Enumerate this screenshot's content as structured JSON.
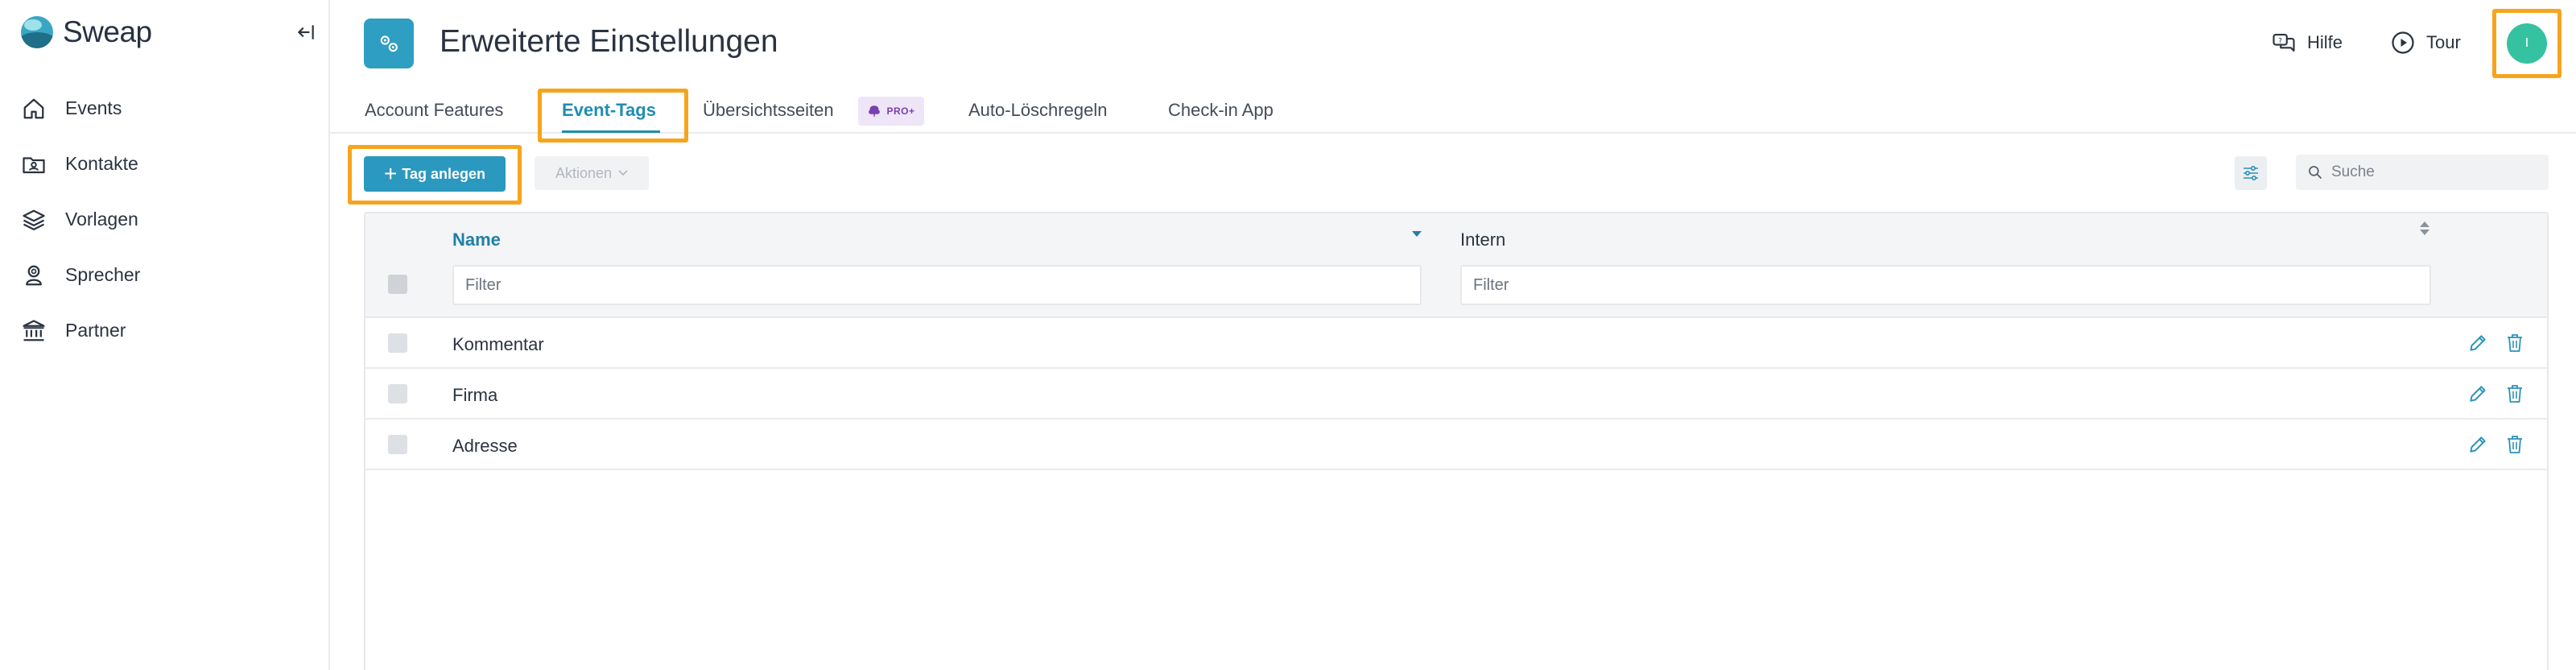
{
  "sidebar": {
    "brand": "Sweap",
    "items": [
      {
        "label": "Events",
        "icon": "home-icon"
      },
      {
        "label": "Kontakte",
        "icon": "contacts-icon"
      },
      {
        "label": "Vorlagen",
        "icon": "layers-icon"
      },
      {
        "label": "Sprecher",
        "icon": "speaker-icon"
      },
      {
        "label": "Partner",
        "icon": "bank-icon"
      }
    ]
  },
  "header": {
    "title": "Erweiterte Einstellungen",
    "help_label": "Hilfe",
    "tour_label": "Tour",
    "avatar_initial": "I"
  },
  "tabs": [
    {
      "label": "Account Features",
      "active": false
    },
    {
      "label": "Event-Tags",
      "active": true
    },
    {
      "label": "Übersichtsseiten",
      "active": false,
      "badge": "PRO+"
    },
    {
      "label": "Auto-Löschregeln",
      "active": false
    },
    {
      "label": "Check-in App",
      "active": false
    }
  ],
  "toolbar": {
    "add_label": "Tag anlegen",
    "actions_label": "Aktionen",
    "search_placeholder": "Suche"
  },
  "table": {
    "columns": [
      {
        "label": "Name",
        "sorted": "desc"
      },
      {
        "label": "Intern",
        "sorted": "none"
      }
    ],
    "filter_placeholder": "Filter",
    "rows": [
      {
        "name": "Kommentar",
        "intern": ""
      },
      {
        "name": "Firma",
        "intern": ""
      },
      {
        "name": "Adresse",
        "intern": ""
      }
    ]
  },
  "colors": {
    "accent": "#2b98bf",
    "highlight": "#f7a41d",
    "avatar": "#35c2a0",
    "pro_badge": "#7a3fb0"
  }
}
